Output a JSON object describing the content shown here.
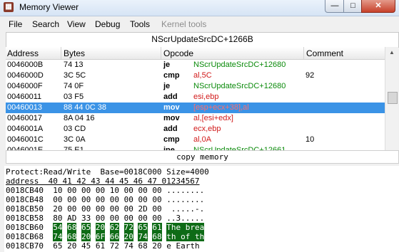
{
  "window": {
    "title": "Memory Viewer",
    "icon": "memory-viewer-icon"
  },
  "menu": [
    "File",
    "Search",
    "View",
    "Debug",
    "Tools",
    "Kernel tools"
  ],
  "disasm": {
    "location": "NScrUpdateSrcDC+1266B",
    "headers": {
      "address": "Address",
      "bytes": "Bytes",
      "opcode": "Opcode",
      "comment": "Comment"
    },
    "rows": [
      {
        "addr": "0046000B",
        "bytes": "74 13",
        "op": "je",
        "arg": "NScrUpdateSrcDC+12680",
        "arg_color": "green",
        "comment": ""
      },
      {
        "addr": "0046000D",
        "bytes": "3C 5C",
        "op": "cmp",
        "arg": "al,5C",
        "arg_color": "red",
        "comment": "92"
      },
      {
        "addr": "0046000F",
        "bytes": "74 0F",
        "op": "je",
        "arg": "NScrUpdateSrcDC+12680",
        "arg_color": "green",
        "comment": ""
      },
      {
        "addr": "00460011",
        "bytes": "03 F5",
        "op": "add",
        "arg": "esi,ebp",
        "arg_color": "red",
        "comment": ""
      },
      {
        "addr": "00460013",
        "bytes": "88 44 0C 38",
        "op": "mov",
        "arg": "[esp+ecx+38],al",
        "arg_color": "red",
        "comment": "",
        "selected": true
      },
      {
        "addr": "00460017",
        "bytes": "8A 04 16",
        "op": "mov",
        "arg": "al,[esi+edx]",
        "arg_color": "red",
        "comment": ""
      },
      {
        "addr": "0046001A",
        "bytes": "03 CD",
        "op": "add",
        "arg": "ecx,ebp",
        "arg_color": "red",
        "comment": ""
      },
      {
        "addr": "0046001C",
        "bytes": "3C 0A",
        "op": "cmp",
        "arg": "al,0A",
        "arg_color": "red",
        "comment": "10"
      },
      {
        "addr": "0046001E",
        "bytes": "75 E1",
        "op": "jne",
        "arg": "NScrUpdateSrcDC+12661",
        "arg_color": "green",
        "comment": ""
      }
    ]
  },
  "copy_memory_label": "copy memory",
  "hex": {
    "info": "Protect:Read/Write  Base=0018C000 Size=4000",
    "header": "address  40 41 42 43 44 45 46 47 01234567",
    "lines": [
      {
        "addr": "0018CB40",
        "bytes": [
          "10",
          "00",
          "00",
          "00",
          "10",
          "00",
          "00",
          "00"
        ],
        "ascii": "........",
        "hl": false
      },
      {
        "addr": "0018CB48",
        "bytes": [
          "00",
          "00",
          "00",
          "00",
          "00",
          "00",
          "00",
          "00"
        ],
        "ascii": "........",
        "hl": false
      },
      {
        "addr": "0018CB50",
        "bytes": [
          "20",
          "00",
          "00",
          "00",
          "00",
          "00",
          "2D",
          "00"
        ],
        "ascii": " .....-.",
        "hl": false
      },
      {
        "addr": "0018CB58",
        "bytes": [
          "80",
          "AD",
          "33",
          "00",
          "00",
          "00",
          "00",
          "00"
        ],
        "ascii": "..3.....",
        "hl": false
      },
      {
        "addr": "0018CB60",
        "bytes": [
          "54",
          "68",
          "65",
          "20",
          "62",
          "72",
          "65",
          "61"
        ],
        "ascii": "The brea",
        "hl": true
      },
      {
        "addr": "0018CB68",
        "bytes": [
          "74",
          "68",
          "20",
          "6F",
          "66",
          "20",
          "74",
          "68"
        ],
        "ascii": "th of th",
        "hl": true
      },
      {
        "addr": "0018CB70",
        "bytes": [
          "65",
          "20",
          "45",
          "61",
          "72",
          "74",
          "68",
          "20"
        ],
        "ascii": "e Earth ",
        "hl": false
      }
    ]
  }
}
